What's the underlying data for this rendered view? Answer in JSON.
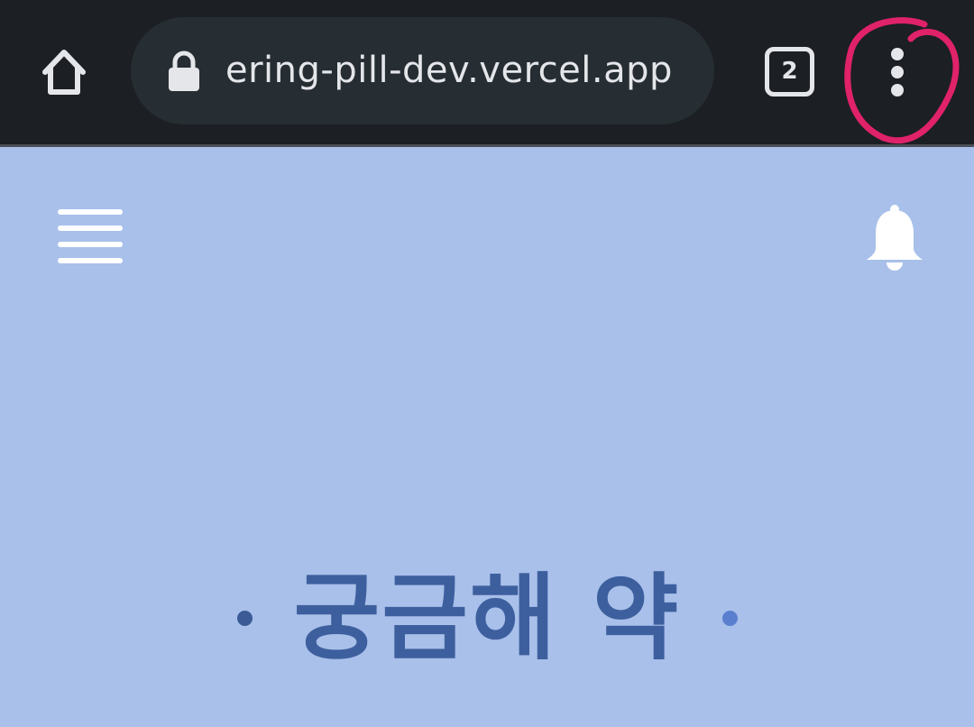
{
  "browser": {
    "url": "ering-pill-dev.vercel.app",
    "tab_count": "2",
    "icons": {
      "home": "home-icon",
      "lock": "lock-icon",
      "tabs": "tab-switcher-icon",
      "menu": "more-vert-icon"
    },
    "colors": {
      "bar": "#1c1f23",
      "pill": "#262e34",
      "foreground": "#e4e6ea",
      "annotation": "#e0226a"
    }
  },
  "app": {
    "background": "#a8c0ea",
    "header": {
      "menu_icon": "hamburger-icon",
      "notification_icon": "bell-icon"
    },
    "hero": {
      "title": "궁금해 약",
      "title_color": "#3e5f9e",
      "dot_left_color": "#3b5a96",
      "dot_right_color": "#5b7fcf"
    }
  }
}
